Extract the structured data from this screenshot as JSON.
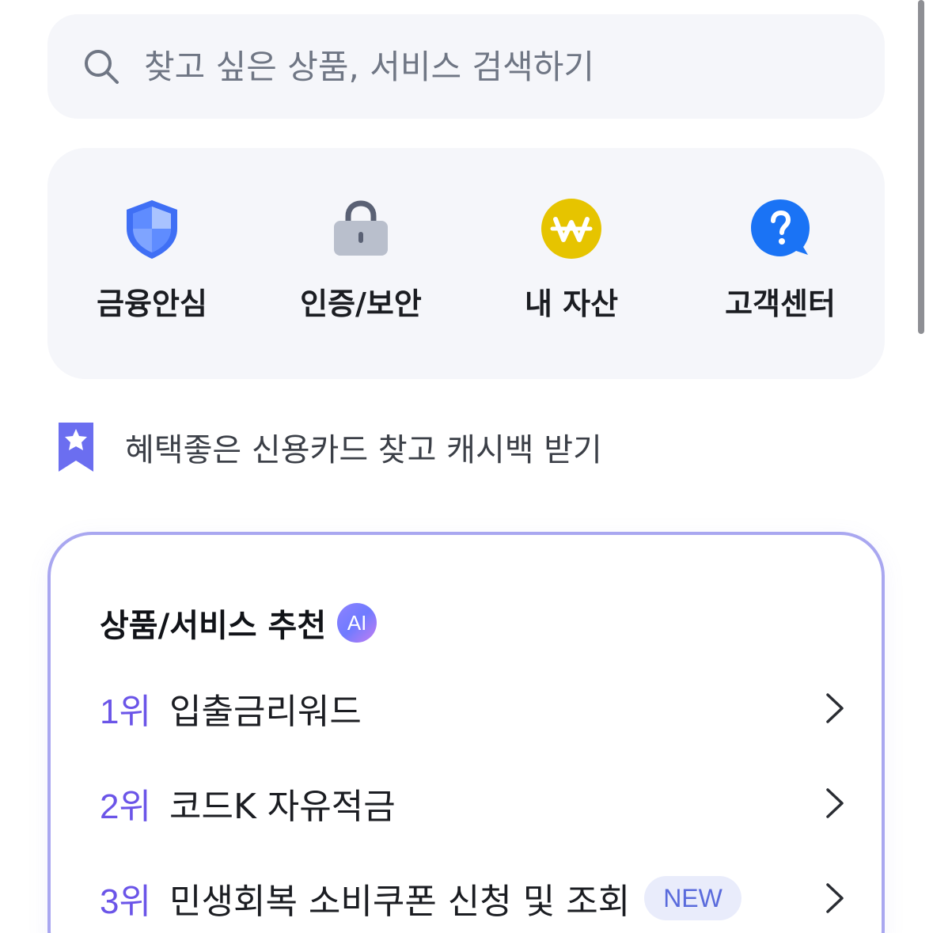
{
  "search": {
    "placeholder": "찾고 싶은 상품, 서비스 검색하기",
    "icon": "search-icon"
  },
  "quick_menu": [
    {
      "label": "금융안심",
      "icon": "shield-icon"
    },
    {
      "label": "인증/보안",
      "icon": "lock-icon"
    },
    {
      "label": "내 자산",
      "icon": "won-coin-icon"
    },
    {
      "label": "고객센터",
      "icon": "help-bubble-icon"
    }
  ],
  "promo": {
    "text": "혜택좋은 신용카드 찾고 캐시백 받기",
    "icon": "bookmark-star-icon"
  },
  "recommend": {
    "title": "상품/서비스 추천",
    "ai_badge": "AI",
    "items": [
      {
        "rank": "1위",
        "name": "입출금리워드"
      },
      {
        "rank": "2위",
        "name": "코드K 자유적금"
      },
      {
        "rank": "3위",
        "name": "민생회복 소비쿠폰 신청 및 조회",
        "badge": "NEW"
      }
    ]
  },
  "colors": {
    "accent": "#6b55e8",
    "card_bg": "#f5f6fa",
    "shield": "#3f6ff5",
    "coin": "#e6c400",
    "help": "#1a73f5",
    "lock": "#b9bfcc"
  }
}
